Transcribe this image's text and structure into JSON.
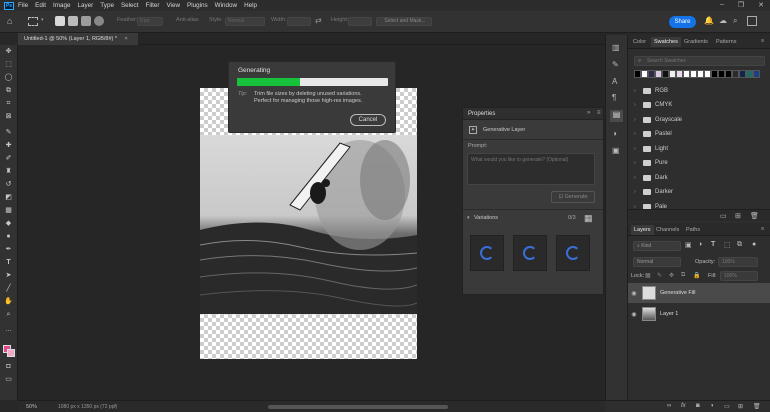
{
  "menu": {
    "logo": "Ps",
    "items": [
      "File",
      "Edit",
      "Image",
      "Layer",
      "Type",
      "Select",
      "Filter",
      "View",
      "Plugins",
      "Window",
      "Help"
    ]
  },
  "options": {
    "feather_label": "Feather:",
    "feather_value": "0 px",
    "antialias": "Anti-alias",
    "style_label": "Style:",
    "style_value": "Normal",
    "width_label": "Width:",
    "height_label": "Height:",
    "select_mask": "Select and Mask...",
    "share": "Share"
  },
  "doc_tab": {
    "title": "Untitled-1 @ 50% (Layer 1, RGB/8#) *",
    "close": "×"
  },
  "generating": {
    "title": "Generating",
    "progress": 0.42,
    "tip_label": "Tip:",
    "tip_line1": "Trim file sizes by deleting unused variations.",
    "tip_line2": "Perfect for managing those high-res images.",
    "cancel": "Cancel"
  },
  "properties": {
    "title": "Properties",
    "layer_type": "Generative Layer",
    "prompt_label": "Prompt:",
    "prompt_placeholder": "What would you like to generate? (Optional)",
    "generate": "Generate",
    "variations_label": "Variations",
    "variations_count": "0/3"
  },
  "right_tabs": {
    "color": "Color",
    "swatches": "Swatches",
    "gradients": "Gradients",
    "patterns": "Patterns",
    "search_placeholder": "Search Swatches"
  },
  "swatch_colors": [
    "#000000",
    "#ffffff",
    "#2e2a4a",
    "#d8c8de",
    "#101010",
    "#f0f0f0",
    "#e9d9ec",
    "#ffffff",
    "#ffffff",
    "#ffffff",
    "#ffffff",
    "#000000",
    "#000000",
    "#000000",
    "#2b2b2b",
    "#12254a",
    "#1d6b62",
    "#1c3f8a"
  ],
  "swatch_groups": [
    "RGB",
    "CMYK",
    "Grayscale",
    "Pastel",
    "Light",
    "Pure",
    "Dark",
    "Darker",
    "Pale"
  ],
  "layers_tabs": {
    "layers": "Layers",
    "channels": "Channels",
    "paths": "Paths",
    "kind": "Kind",
    "blend": "Normal",
    "opacity_label": "Opacity:",
    "opacity_value": "100%",
    "lock_label": "Lock:",
    "fill_label": "Fill:",
    "fill_value": "100%"
  },
  "layers": [
    {
      "name": "Generative Fill"
    },
    {
      "name": "Layer 1"
    }
  ],
  "status": {
    "zoom": "50%",
    "doc_size": "1080 px x 1350 px (72 ppi)"
  },
  "colors": {
    "accent": "#1473e6",
    "progress": "#18c23a",
    "panel": "#3a3a3a"
  }
}
